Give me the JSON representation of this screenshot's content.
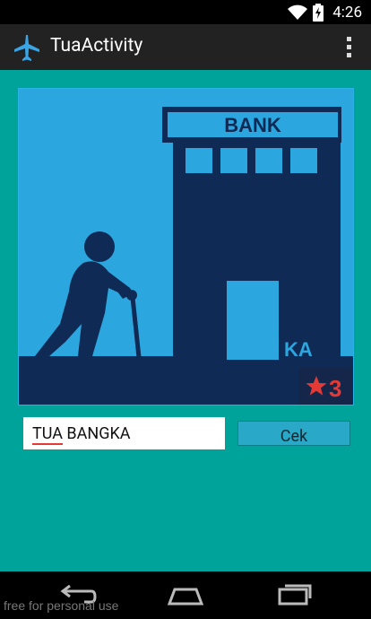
{
  "status_bar": {
    "time": "4:26",
    "icons": [
      "wifi-icon",
      "battery-icon"
    ]
  },
  "action_bar": {
    "title": "TuaActivity",
    "app_icon": "airplane-icon",
    "menu_icon": "overflow-menu-icon"
  },
  "puzzle_image": {
    "sign_text": "BANK",
    "corner_text": "KA",
    "badge_value": "3",
    "badge_icon": "star-icon",
    "colors": {
      "sky": "#2ba6de",
      "silhouette": "#0f2a55",
      "badge_bg": "#14264a",
      "star": "#e53935"
    }
  },
  "answer": {
    "value_part1": "TUA",
    "value_part2": " BANGKA"
  },
  "cek_button": {
    "label": "Cek"
  },
  "nav_bar": {
    "icons": [
      "back-icon",
      "home-icon",
      "recents-icon"
    ]
  },
  "watermark": "free for personal use"
}
